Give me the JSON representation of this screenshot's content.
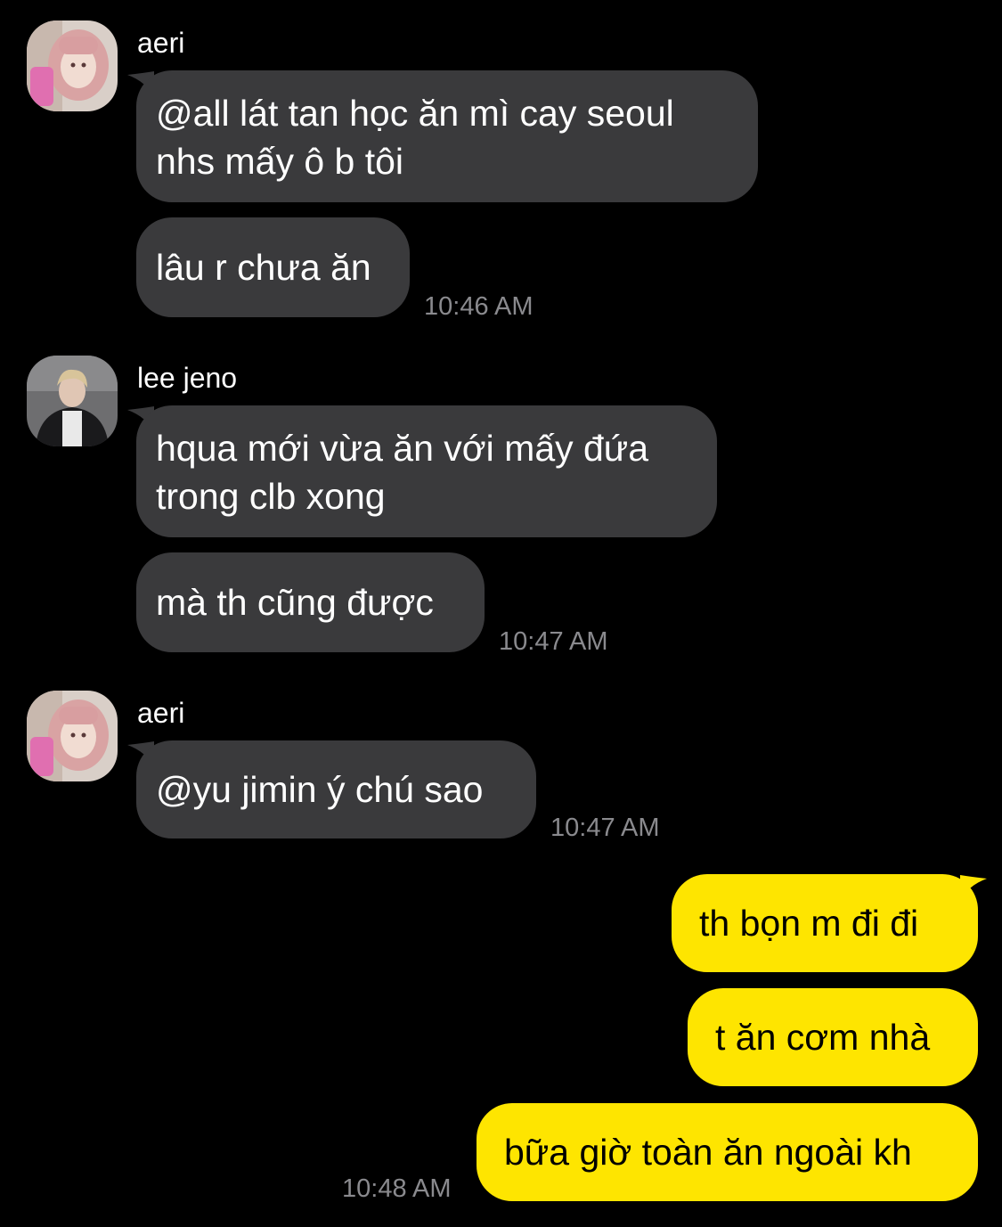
{
  "theme": {
    "background": "#000000",
    "incoming_bubble": "#3a3a3c",
    "outgoing_bubble": "#fee500",
    "timestamp_color": "#8a8a8e"
  },
  "groups": [
    {
      "sender": "aeri",
      "avatar_icon": "aeri-avatar",
      "messages": [
        "@all lát tan học ăn mì cay seoul nhs mấy ô b tôi",
        "lâu r chưa ăn"
      ],
      "time": "10:46 AM"
    },
    {
      "sender": "lee jeno",
      "avatar_icon": "lee-jeno-avatar",
      "messages": [
        "hqua mới vừa ăn với mấy đứa trong clb xong",
        "mà th cũng được"
      ],
      "time": "10:47 AM"
    },
    {
      "sender": "aeri",
      "avatar_icon": "aeri-avatar",
      "messages": [
        "@yu jimin ý chú sao"
      ],
      "time": "10:47 AM"
    },
    {
      "sender": "me",
      "messages": [
        "th bọn m đi đi",
        "t ăn cơm nhà",
        "bữa giờ toàn ăn ngoài kh"
      ],
      "time": "10:48 AM"
    }
  ]
}
